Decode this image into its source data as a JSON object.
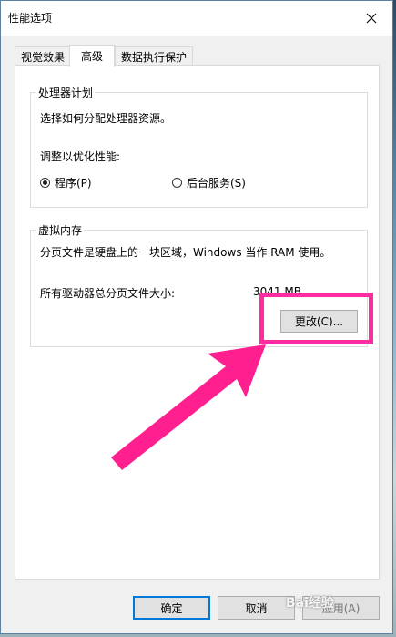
{
  "window": {
    "title": "性能选项"
  },
  "tabs": [
    {
      "label": "视觉效果"
    },
    {
      "label": "高级"
    },
    {
      "label": "数据执行保护"
    }
  ],
  "processor": {
    "group_title": "处理器计划",
    "description": "选择如何分配处理器资源。",
    "adjust_label": "调整以优化性能:",
    "option_programs": "程序(P)",
    "option_background": "后台服务(S)",
    "selected": "programs"
  },
  "virtual_memory": {
    "group_title": "虚拟内存",
    "description": "分页文件是硬盘上的一块区域，Windows 当作 RAM 使用。",
    "total_label": "所有驱动器总分页文件大小:",
    "total_value": "3041 MB",
    "change_button": "更改(C)..."
  },
  "footer": {
    "ok": "确定",
    "cancel": "取消",
    "apply": "应用(A)"
  },
  "watermark": "Bai经验",
  "colors": {
    "highlight": "#ff2ba0",
    "default_button_border": "#0078d7"
  }
}
